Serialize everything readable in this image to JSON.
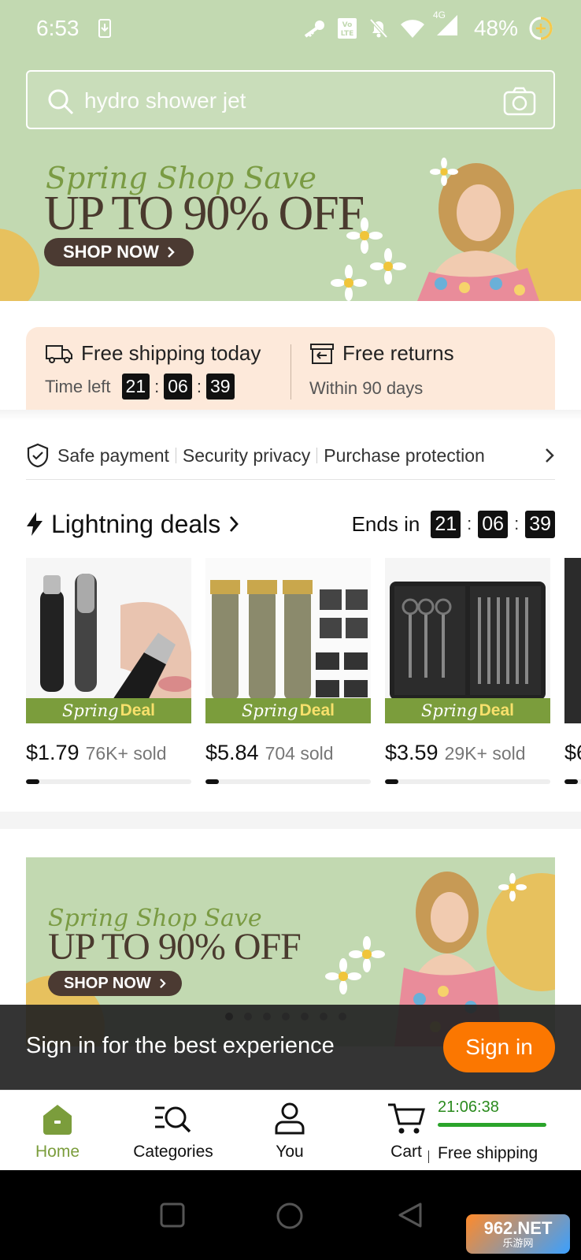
{
  "status_bar": {
    "time": "6:53",
    "battery": "48%",
    "network": "4G"
  },
  "search": {
    "placeholder": "hydro shower jet"
  },
  "hero_banner": {
    "script_text": "Spring Shop Save",
    "headline": "UP TO 90% OFF",
    "cta": "SHOP NOW"
  },
  "shipping": {
    "free_shipping": "Free shipping today",
    "time_left_label": "Time left",
    "timer": {
      "h": "21",
      "m": "06",
      "s": "39"
    },
    "free_returns": "Free returns",
    "returns_sub": "Within 90 days"
  },
  "trust": {
    "items": [
      "Safe payment",
      "Security privacy",
      "Purchase protection"
    ]
  },
  "lightning": {
    "title": "Lightning deals",
    "ends_label": "Ends in",
    "timer": {
      "h": "21",
      "m": "06",
      "s": "39"
    },
    "deal_badge": {
      "part1": "Spring",
      "part2": "Deal"
    },
    "products": [
      {
        "price": "$1.79",
        "sold": "76K+ sold",
        "progress": 0.08,
        "image": "nose-trimmer"
      },
      {
        "price": "$5.84",
        "sold": "704 sold",
        "progress": 0.08,
        "image": "hair-clippers"
      },
      {
        "price": "$3.59",
        "sold": "29K+ sold",
        "progress": 0.08,
        "image": "manicure-kit"
      },
      {
        "price": "$6",
        "sold": "",
        "progress": 0.08,
        "image": "partial"
      }
    ]
  },
  "banner2": {
    "script_text": "Spring Shop Save",
    "headline": "UP TO 90% OFF",
    "cta": "SHOP NOW"
  },
  "signin_bar": {
    "text": "Sign in for the best experience",
    "button": "Sign in"
  },
  "tabbar": {
    "home": "Home",
    "categories": "Categories",
    "you": "You",
    "cart": "Cart",
    "cart_timer": "21:06:38",
    "cart_shipping": "Free shipping"
  },
  "watermark": {
    "line1": "962.NET",
    "line2": "乐游网"
  },
  "colors": {
    "brand_green": "#7b9d3c",
    "orange": "#fb7701",
    "hero_bg": "#c2d9b1"
  }
}
